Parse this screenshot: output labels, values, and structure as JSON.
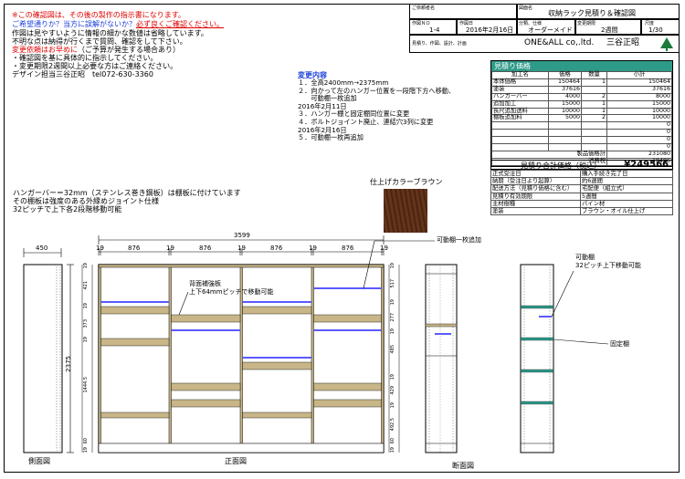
{
  "notice": {
    "line1": "※この確認図は、その後の製作の指示書になります。",
    "line2a": "ご希望通りか？当方に誤解がないか？",
    "line2b": "必ず良くご確認ください。",
    "line3": "作図は見やすいように情報の細かな数値は省略しています。",
    "line4": "不明な点は納得が行くまで質問、確認をして下さい。",
    "line5a": "変更依頼はお早めに",
    "line5b": "（ご予算が発生する場合あり）",
    "line6": "・確認図を基に具体的に指示してください。",
    "line7": "・変更期限2週間以上必要な方はご連絡ください。",
    "line8": "デザイン担当三谷正昭　tel072-630-3360"
  },
  "header": {
    "customer_label": "ご依頼者名",
    "drawing_label": "図面名",
    "drawing_name": "収納ラック見積り＆確認図",
    "sheet_no_label": "作図ＮＯ",
    "sheet_no": "1-4",
    "date_label": "作図日",
    "date": "2016年2月16日",
    "type_label": "分類、仕様",
    "type": "オーダーメイド",
    "period_label": "変更期限",
    "period": "2週間",
    "scale_label": "尺度",
    "scale": "1/30",
    "role_label": "見積り、作図、設計、計画",
    "company": "ONE&ALL co,.ltd.",
    "designer": "三谷正昭"
  },
  "changes": {
    "title": "変更内容",
    "items": [
      "１．全高2400mm→2375mm",
      "２．向かって左のハンガー位置を一段階下方へ移動、",
      "　　可動棚一枚追加",
      "2016年2月11日",
      "３．ハンガー棚と固定棚同位置に変更",
      "４．ボルトジョイント廃止、連結穴3列に変更",
      "2016年2月16日",
      "５．可動棚一枚再追加"
    ]
  },
  "estimate": {
    "title": "見積り価格",
    "headers": [
      "加工名",
      "価格",
      "数量",
      "小計"
    ],
    "rows": [
      [
        "本体価格",
        "150464",
        "1",
        "150464"
      ],
      [
        "塗装",
        "37616",
        "",
        "37616"
      ],
      [
        "ハンガーバー",
        "4000",
        "2",
        "8000"
      ],
      [
        "追加加工",
        "15000",
        "1",
        "15000"
      ],
      [
        "長尺追加送料",
        "10000",
        "1",
        "10000"
      ],
      [
        "棚板追加料",
        "5000",
        "2",
        "10000"
      ],
      [
        "",
        "",
        "",
        "0"
      ],
      [
        "",
        "",
        "",
        "0"
      ],
      [
        "",
        "",
        "",
        "0"
      ],
      [
        "",
        "",
        "",
        "0"
      ]
    ],
    "product_total_label": "製品価格計",
    "product_total": "231080",
    "tax_label": "消費税",
    "tax": "18486",
    "grand_total_label": "見積り合計価格（税込）",
    "grand_total": "¥249566"
  },
  "info": [
    [
      "正式受注日",
      "購入手続き完了日"
    ],
    [
      "納期（受注日より起算）",
      "約6週間"
    ],
    [
      "配送方法（見積り価格に含む）",
      "宅配便（組立式）"
    ],
    [
      "見積り有効期限",
      "5週間"
    ],
    [
      "主材樹種",
      "パイン材"
    ],
    [
      "塗装",
      "ブラウン・オイル仕上げ"
    ]
  ],
  "notes": {
    "line1": "ハンガーバー＝32mm（ステンレス巻き鋼板）は棚板に付けています",
    "line2": "その棚板は強度のある外縁めジョイント仕様",
    "line3": "32ピッチで上下各2段階移動可能"
  },
  "color_sample_label": "仕上げカラーブラウン",
  "dims": {
    "side_depth": "450",
    "total_width": "3599",
    "height": "2375",
    "widths": [
      "19",
      "876",
      "19",
      "876",
      "19",
      "876",
      "19",
      "876",
      "19"
    ],
    "left_col_h": [
      "19",
      "421",
      "19",
      "373",
      "19",
      "1444.5",
      "60",
      "19"
    ],
    "right_col_h": [
      "19",
      "517",
      "19",
      "277",
      "19",
      "485",
      "19",
      "429",
      "19",
      "492.5",
      "60",
      "19"
    ]
  },
  "callouts": {
    "back_brace": "背面補強板",
    "back_brace_2": "上下64mmピッチで移動可能",
    "added_shelf": "可動棚一枚追加",
    "movable_shelf": "可動棚",
    "movable_shelf_2": "32ピッチ上下移動可能",
    "fixed_shelf": "固定棚"
  },
  "view_labels": {
    "side": "側面図",
    "front": "正面図",
    "section": "断面図"
  },
  "colors": {
    "estimate_header": "#2e9a88",
    "shelf_wood": "#c8b688",
    "hanger_bar": "#5a5aff",
    "color_sample": "#5a2a10",
    "notice_red": "#e00000",
    "notice_blue": "#1a3fd8",
    "logo_green": "#1a7a3a"
  }
}
